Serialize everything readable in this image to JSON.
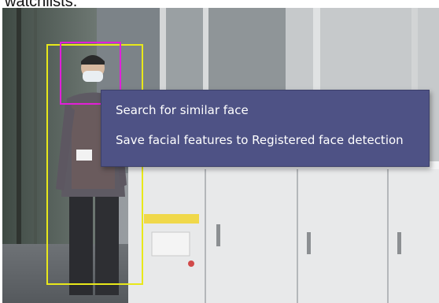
{
  "caption": {
    "text": "watchlists."
  },
  "detections": {
    "person_box_color": "#e8e81a",
    "face_box_color": "#e020d8"
  },
  "context_menu": {
    "background_color": "#4e5285",
    "items": [
      {
        "label": "Search for similar face"
      },
      {
        "label": "Save facial features to Registered face detection"
      }
    ]
  }
}
